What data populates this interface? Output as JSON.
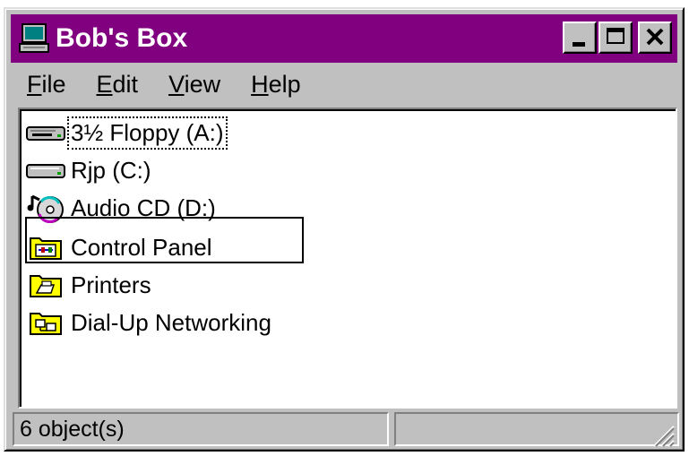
{
  "window": {
    "title": "Bob's Box",
    "title_bar_color": "#800080",
    "icon": "computer-icon",
    "controls": [
      "minimize-button",
      "maximize-button",
      "close-button"
    ]
  },
  "menu": [
    {
      "label": "File",
      "mnemonic": "F",
      "rest": "ile"
    },
    {
      "label": "Edit",
      "mnemonic": "E",
      "rest": "dit"
    },
    {
      "label": "View",
      "mnemonic": "V",
      "rest": "iew"
    },
    {
      "label": "Help",
      "mnemonic": "H",
      "rest": "elp"
    }
  ],
  "items": [
    {
      "label": "3½ Floppy (A:)",
      "icon": "floppy-drive-icon",
      "focused": true
    },
    {
      "label": "Rjp (C:)",
      "icon": "hard-drive-icon"
    },
    {
      "label": "Audio CD (D:)",
      "icon": "audio-cd-icon"
    },
    {
      "label": "Control Panel",
      "icon": "control-panel-folder-icon",
      "highlighted": true
    },
    {
      "label": "Printers",
      "icon": "printers-folder-icon"
    },
    {
      "label": "Dial-Up Networking",
      "icon": "dialup-folder-icon"
    }
  ],
  "status": {
    "object_count": "6 object(s)",
    "right_panel": ""
  }
}
